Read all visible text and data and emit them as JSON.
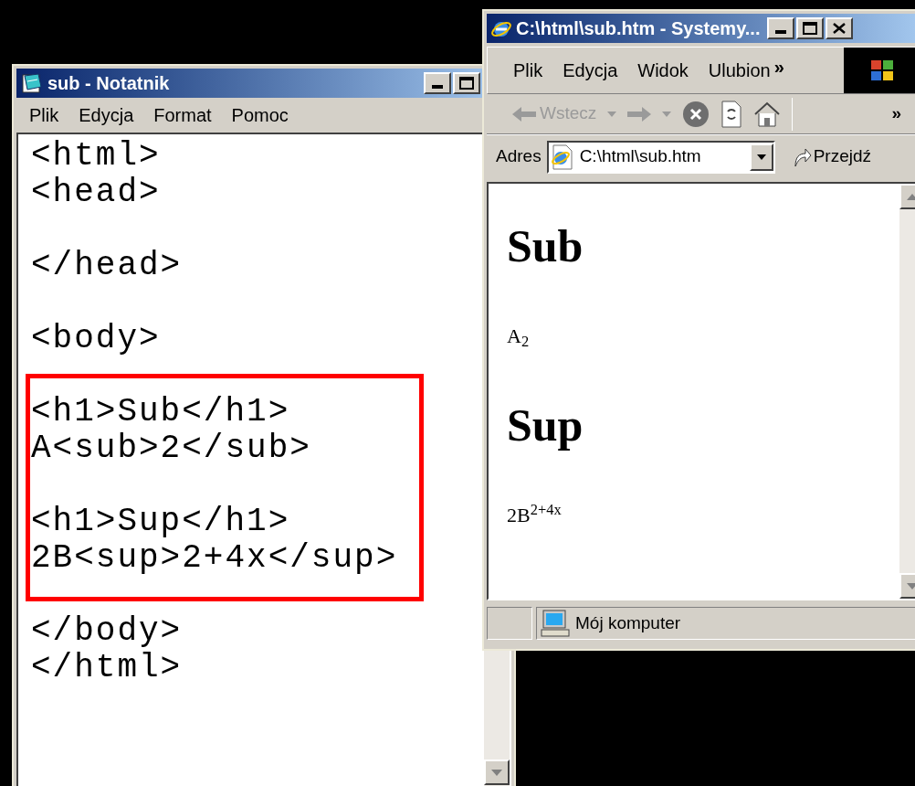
{
  "notepad": {
    "title": "sub - Notatnik",
    "menu": [
      "Plik",
      "Edycja",
      "Format",
      "Pomoc"
    ],
    "blocks": [
      {
        "lines": [
          "<html>",
          "<head>"
        ],
        "highlighted": false
      },
      {
        "lines": [
          "</head>"
        ],
        "highlighted": false
      },
      {
        "lines": [
          "<body>"
        ],
        "highlighted": false
      },
      {
        "lines": [
          "<h1>Sub</h1>",
          "A<sub>2</sub>"
        ],
        "highlighted": true
      },
      {
        "lines": [
          "<h1>Sup</h1>",
          "2B<sup>2+4x</sup>"
        ],
        "highlighted": true
      },
      {
        "lines": [
          "</body>",
          "</html>"
        ],
        "highlighted": false
      }
    ]
  },
  "browser": {
    "title": "C:\\html\\sub.htm - Systemy...",
    "menu": [
      "Plik",
      "Edycja",
      "Widok",
      "Ulubion"
    ],
    "menu_overflow": "»",
    "back": {
      "label": "Wstecz",
      "disabled": true
    },
    "toolbar_overflow": "»",
    "address": {
      "label": "Adres",
      "value": "C:\\html\\sub.htm"
    },
    "go": "Przejdź",
    "content": [
      {
        "kind": "heading",
        "text": "Sub"
      },
      {
        "kind": "paragraph",
        "text": "A$_{2}$"
      },
      {
        "kind": "heading",
        "text": "Sup"
      },
      {
        "kind": "paragraph",
        "text": "2B$^{2+4x}$"
      }
    ],
    "status": "Mój komputer"
  }
}
